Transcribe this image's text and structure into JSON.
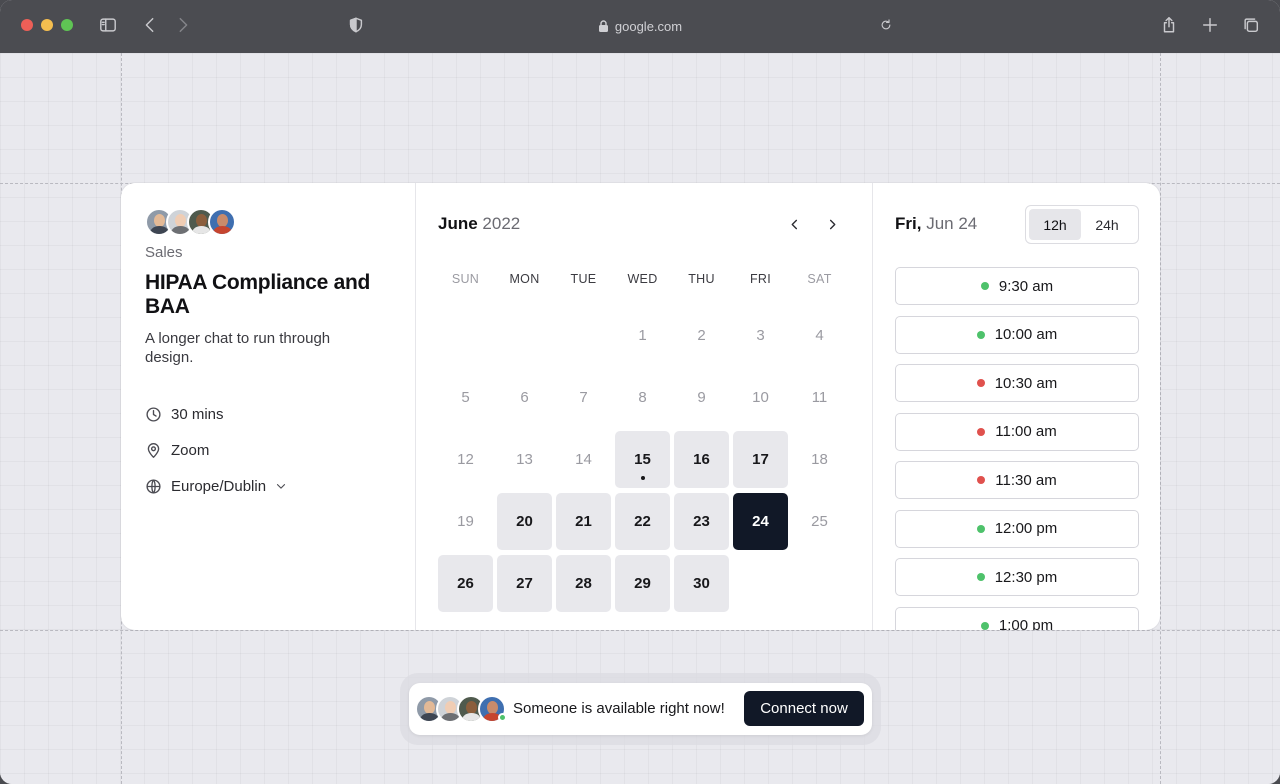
{
  "browser": {
    "address": "google.com",
    "icons": [
      "sidebar-icon",
      "back-icon",
      "forward-icon",
      "shield-icon",
      "lock-icon",
      "reload-icon",
      "share-icon",
      "new-tab-icon",
      "tabs-icon"
    ]
  },
  "event": {
    "team": "Sales",
    "title": "HIPAA Compliance and BAA",
    "description": "A longer chat to run through design.",
    "duration": "30 mins",
    "location": "Zoom",
    "timezone": "Europe/Dublin"
  },
  "calendar": {
    "month": "June",
    "year": "2022",
    "weekdays": [
      "SUN",
      "MON",
      "TUE",
      "WED",
      "THU",
      "FRI",
      "SAT"
    ],
    "weeks": [
      [
        "",
        "",
        "",
        "1",
        "2",
        "3",
        "4"
      ],
      [
        "5",
        "6",
        "7",
        "8",
        "9",
        "10",
        "11"
      ],
      [
        "12",
        "13",
        "14",
        "15",
        "16",
        "17",
        "18"
      ],
      [
        "19",
        "20",
        "21",
        "22",
        "23",
        "24",
        "25"
      ],
      [
        "26",
        "27",
        "28",
        "29",
        "30",
        "",
        ""
      ]
    ],
    "available": [
      "15",
      "16",
      "17",
      "20",
      "21",
      "22",
      "23",
      "26",
      "27",
      "28",
      "29",
      "30"
    ],
    "selected": "24",
    "today_marker": "15"
  },
  "times": {
    "selected_day": "Fri,",
    "selected_date": "Jun 24",
    "format_options": [
      "12h",
      "24h"
    ],
    "active_format": "12h",
    "slots": [
      {
        "time": "9:30 am",
        "status": "available"
      },
      {
        "time": "10:00 am",
        "status": "available"
      },
      {
        "time": "10:30 am",
        "status": "busy"
      },
      {
        "time": "11:00 am",
        "status": "busy"
      },
      {
        "time": "11:30 am",
        "status": "busy"
      },
      {
        "time": "12:00 pm",
        "status": "available"
      },
      {
        "time": "12:30 pm",
        "status": "available"
      },
      {
        "time": "1:00 pm",
        "status": "available"
      }
    ],
    "status_colors": {
      "available": "#4ec26b",
      "busy": "#e0514d"
    }
  },
  "toast": {
    "message": "Someone is available right now!",
    "button": "Connect now"
  },
  "colors": {
    "accent": "#111827",
    "available_bg": "#e8e8ec"
  }
}
